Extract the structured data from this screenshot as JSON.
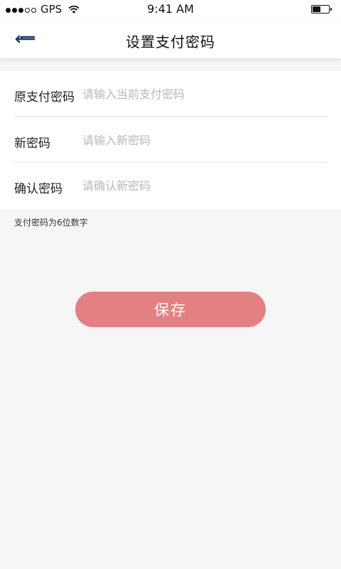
{
  "status_bar": {
    "carrier": "GPS",
    "time": "9:41 AM",
    "signal_strength": 3,
    "signal_max": 5,
    "battery_level": 0.5,
    "icons": [
      "signal-icon",
      "wifi-icon",
      "battery-icon"
    ]
  },
  "nav": {
    "title": "设置支付密码",
    "back_icon": "back-arrow-icon",
    "accent_color": "#1c3a6b"
  },
  "form": {
    "rows": [
      {
        "label": "原支付密码",
        "placeholder": "请输入当前支付密码",
        "value": ""
      },
      {
        "label": "新密码",
        "placeholder": "请输入新密码",
        "value": ""
      },
      {
        "label": "确认密码",
        "placeholder": "请确认新密码",
        "value": ""
      }
    ]
  },
  "hint": "支付密码为6位数字",
  "save_button": {
    "label": "保存",
    "color": "#e48083"
  }
}
